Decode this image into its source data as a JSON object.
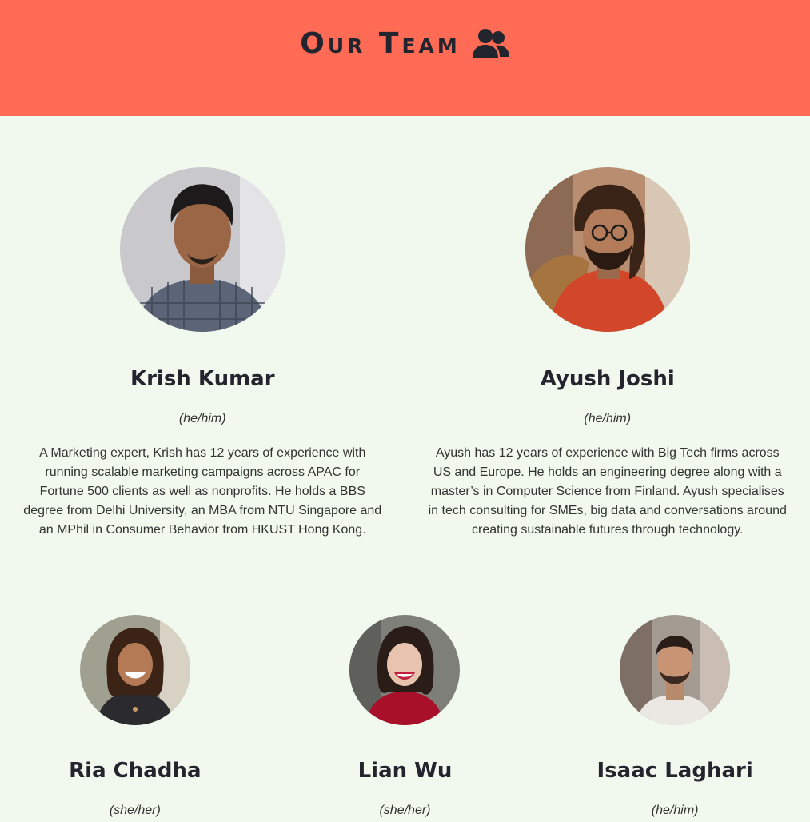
{
  "header": {
    "title": "Our Team",
    "icon": "users-icon",
    "background": "#ff6b54"
  },
  "team_top": [
    {
      "name": "Krish Kumar",
      "pronoun": "(he/him)",
      "bio": "A Marketing expert, Krish has 12 years of experience with running scalable marketing campaigns across APAC for Fortune 500 clients as well as nonprofits. He holds a BBS degree from Delhi University, an MBA from NTU Singapore and an MPhil in Consumer Behavior from HKUST Hong Kong."
    },
    {
      "name": "Ayush Joshi",
      "pronoun": "(he/him)",
      "bio": "Ayush has 12 years of experience with Big Tech firms across US and Europe. He holds an engineering degree along with a master’s in Computer Science from Finland. Ayush specialises in tech consulting for SMEs, big data and conversations around creating sustainable futures through technology."
    }
  ],
  "team_bottom": [
    {
      "name": "Ria Chadha",
      "pronoun": "(she/her)"
    },
    {
      "name": "Lian Wu",
      "pronoun": "(she/her)"
    },
    {
      "name": "Isaac Laghari",
      "pronoun": "(he/him)"
    }
  ],
  "colors": {
    "accent": "#ff6b54",
    "page_background": "#f1f9ee",
    "text": "#22252e"
  }
}
